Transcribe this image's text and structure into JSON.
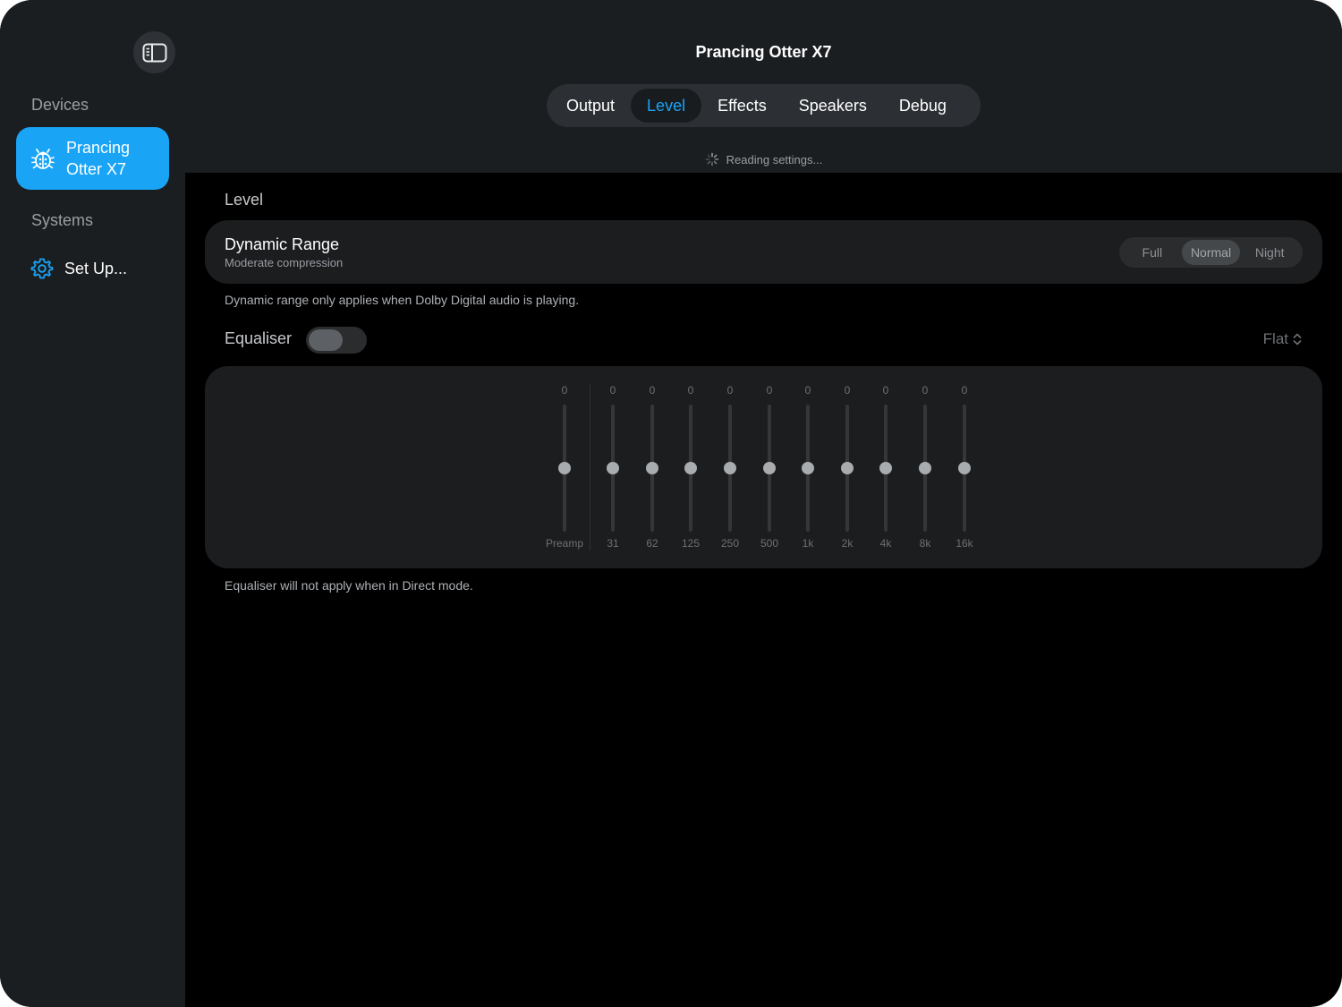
{
  "sidebar": {
    "devices_title": "Devices",
    "systems_title": "Systems",
    "device_item": {
      "label": "Prancing Otter X7",
      "icon": "ladybug-icon"
    },
    "setup_item": {
      "label": "Set Up...",
      "icon": "gear-icon"
    }
  },
  "header": {
    "title": "Prancing Otter X7",
    "tabs": [
      {
        "label": "Output"
      },
      {
        "label": "Level",
        "active": true
      },
      {
        "label": "Effects"
      },
      {
        "label": "Speakers"
      },
      {
        "label": "Debug"
      }
    ],
    "status": "Reading settings..."
  },
  "level": {
    "heading": "Level",
    "dynamic_range": {
      "title": "Dynamic Range",
      "subtitle": "Moderate compression",
      "options": [
        "Full",
        "Normal",
        "Night"
      ],
      "selected": "Normal",
      "note": "Dynamic range only applies when Dolby Digital audio is playing."
    },
    "equaliser": {
      "heading": "Equaliser",
      "enabled": false,
      "preset": "Flat",
      "bands": [
        {
          "label": "Preamp",
          "value": "0",
          "level": 0.5
        },
        {
          "label": "31",
          "value": "0",
          "level": 0.5
        },
        {
          "label": "62",
          "value": "0",
          "level": 0.5
        },
        {
          "label": "125",
          "value": "0",
          "level": 0.5
        },
        {
          "label": "250",
          "value": "0",
          "level": 0.5
        },
        {
          "label": "500",
          "value": "0",
          "level": 0.5
        },
        {
          "label": "1k",
          "value": "0",
          "level": 0.5
        },
        {
          "label": "2k",
          "value": "0",
          "level": 0.5
        },
        {
          "label": "4k",
          "value": "0",
          "level": 0.5
        },
        {
          "label": "8k",
          "value": "0",
          "level": 0.5
        },
        {
          "label": "16k",
          "value": "0",
          "level": 0.5
        }
      ],
      "note": "Equaliser will not apply when in Direct mode."
    }
  },
  "colors": {
    "accent": "#1aa4f6",
    "sidebar_bg": "#1b1e21",
    "card_bg": "#1c1d1f"
  }
}
